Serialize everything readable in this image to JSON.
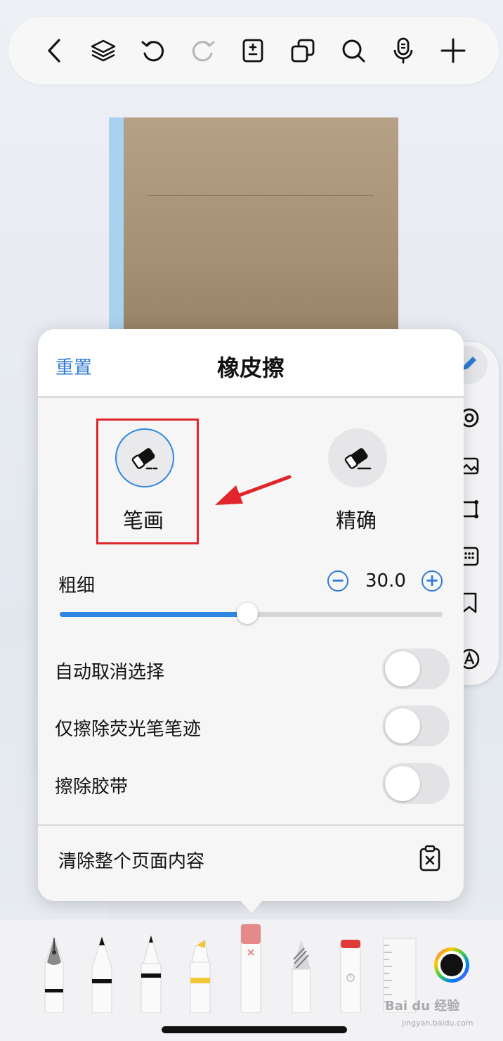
{
  "popover": {
    "reset_label": "重置",
    "title": "橡皮擦",
    "modes": [
      {
        "label": "笔画",
        "selected": true,
        "icon": "eraser-stroke-icon"
      },
      {
        "label": "精确",
        "selected": false,
        "icon": "eraser-precise-icon"
      }
    ],
    "thickness": {
      "label": "粗细",
      "value": "30.0",
      "minus": "−",
      "plus": "+",
      "fraction": 0.49
    },
    "toggles": [
      {
        "label": "自动取消选择",
        "on": false
      },
      {
        "label": "仅擦除荧光笔笔迹",
        "on": false
      },
      {
        "label": "擦除胶带",
        "on": false
      }
    ],
    "clear_label": "清除整个页面内容"
  },
  "toolbar": {
    "icons": [
      "back-chevron-icon",
      "layers-icon",
      "undo-icon",
      "redo-icon",
      "page-document-icon",
      "duplicate-pages-icon",
      "search-icon",
      "microphone-icon",
      "add-icon"
    ]
  },
  "side_rail": {
    "icons": [
      "pen-icon",
      "lasso-icon",
      "image-icon",
      "crop-shape-icon",
      "keyboard-icon",
      "bookmark-icon",
      "text-icon"
    ]
  },
  "tray": {
    "tools": [
      "fountain-pen",
      "ballpoint-pen",
      "fineliner-pen",
      "highlighter",
      "eraser",
      "pencil",
      "brush-pen",
      "ruler"
    ],
    "active_tool": "eraser"
  },
  "watermark": {
    "brand": "Bai du 经验",
    "url": "jingyan.baidu.com"
  },
  "colors": {
    "accent": "#2f86e0",
    "link": "#2f7bd6",
    "highlight": "#e0262b"
  }
}
